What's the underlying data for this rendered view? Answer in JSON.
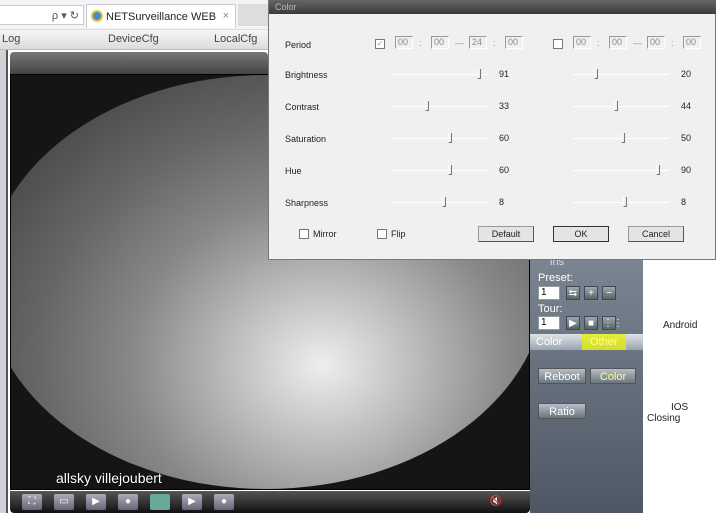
{
  "browser": {
    "address_icons": "ρ ▾ ↻",
    "tab_title": "NETSurveillance WEB",
    "tab_close": "×"
  },
  "menu": [
    "Log",
    "DeviceCfg",
    "LocalCfg"
  ],
  "video": {
    "caption": "allsky villejoubert"
  },
  "toolbar": {
    "icons": [
      "fullscreen-icon",
      "single-view-icon",
      "record-start-icon",
      "record-stop-icon",
      "snapshot-icon",
      "talk-start-icon",
      "talk-stop-icon"
    ],
    "volume_icon": "speaker-muted-icon"
  },
  "sidebar": {
    "iris_label": "ins",
    "preset_label": "Preset:",
    "preset_value": "1",
    "tour_label": "Tour:",
    "tour_value": "1",
    "tabs": [
      "Color",
      "Other"
    ],
    "buttons": {
      "reboot": "Reboot",
      "color": "Color",
      "ratio": "Ratio"
    },
    "highlight_color": "#e6f000"
  },
  "right_panel": {
    "android": "Android",
    "ios": "IOS",
    "closing": "Closing"
  },
  "dialog": {
    "title": "Color",
    "period_label": "Period",
    "period1": {
      "checked": true,
      "start_h": "00",
      "start_m": "00",
      "end_h": "24",
      "end_m": "00"
    },
    "period2": {
      "checked": false,
      "start_h": "00",
      "start_m": "00",
      "end_h": "00",
      "end_m": "00"
    },
    "rows": [
      {
        "label": "Brightness",
        "left": {
          "value": "91",
          "level": 0.91
        },
        "right": {
          "value": "20",
          "level": 0.24
        }
      },
      {
        "label": "Contrast",
        "left": {
          "value": "33",
          "level": 0.35
        },
        "right": {
          "value": "44",
          "level": 0.45
        }
      },
      {
        "label": "Saturation",
        "left": {
          "value": "60",
          "level": 0.6
        },
        "right": {
          "value": "50",
          "level": 0.53
        }
      },
      {
        "label": "Hue",
        "left": {
          "value": "60",
          "level": 0.6
        },
        "right": {
          "value": "90",
          "level": 0.9
        }
      },
      {
        "label": "Sharpness",
        "left": {
          "value": "8",
          "level": 0.54
        },
        "right": {
          "value": "8",
          "level": 0.55
        }
      }
    ],
    "mirror": "Mirror",
    "flip": "Flip",
    "default": "Default",
    "ok": "OK",
    "cancel": "Cancel"
  }
}
